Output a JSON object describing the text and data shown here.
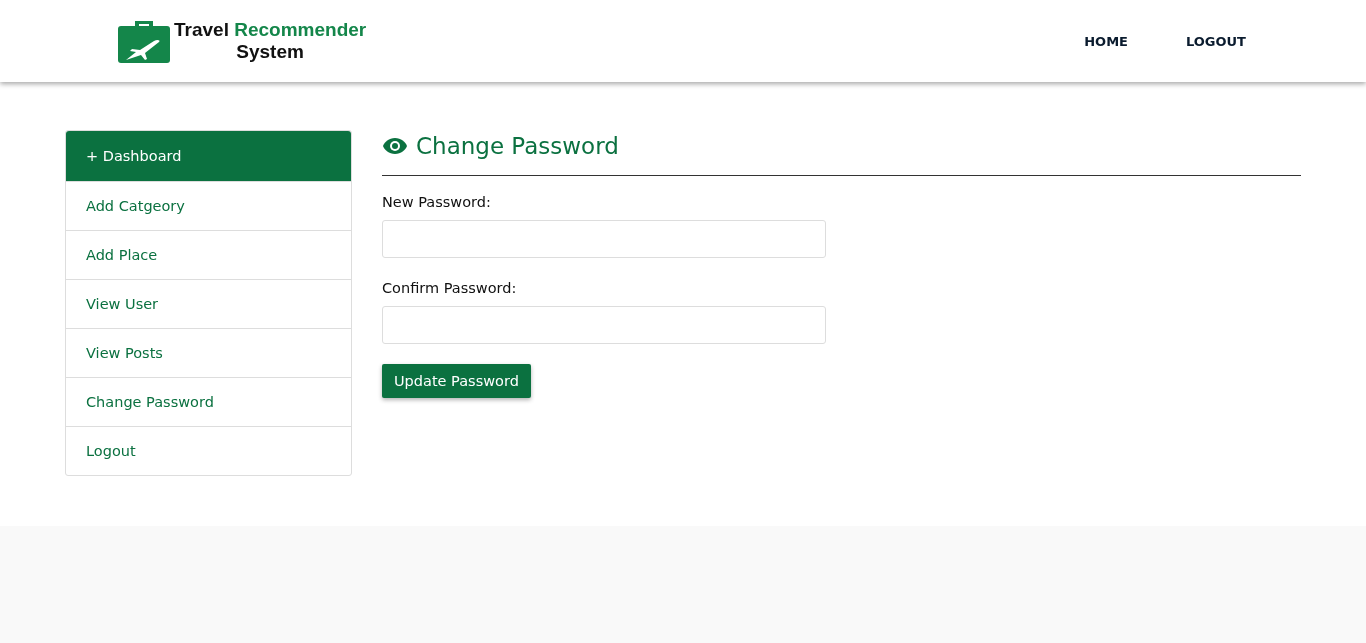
{
  "header": {
    "logo": {
      "word_1": "Travel",
      "word_2": "Recommender",
      "word_3": "System"
    },
    "nav": [
      {
        "label": "HOME"
      },
      {
        "label": "LOGOUT"
      }
    ]
  },
  "sidebar": {
    "items": [
      {
        "label": "+ Dashboard",
        "selected": true
      },
      {
        "label": "Add Catgeory",
        "selected": false
      },
      {
        "label": "Add Place",
        "selected": false
      },
      {
        "label": "View User",
        "selected": false
      },
      {
        "label": "View Posts",
        "selected": false
      },
      {
        "label": "Change Password",
        "selected": false
      },
      {
        "label": "Logout",
        "selected": false
      }
    ]
  },
  "form": {
    "title": "Change Password",
    "fields": [
      {
        "label": "New Password:"
      },
      {
        "label": "Confirm Password:"
      }
    ],
    "button": "Update Password"
  }
}
